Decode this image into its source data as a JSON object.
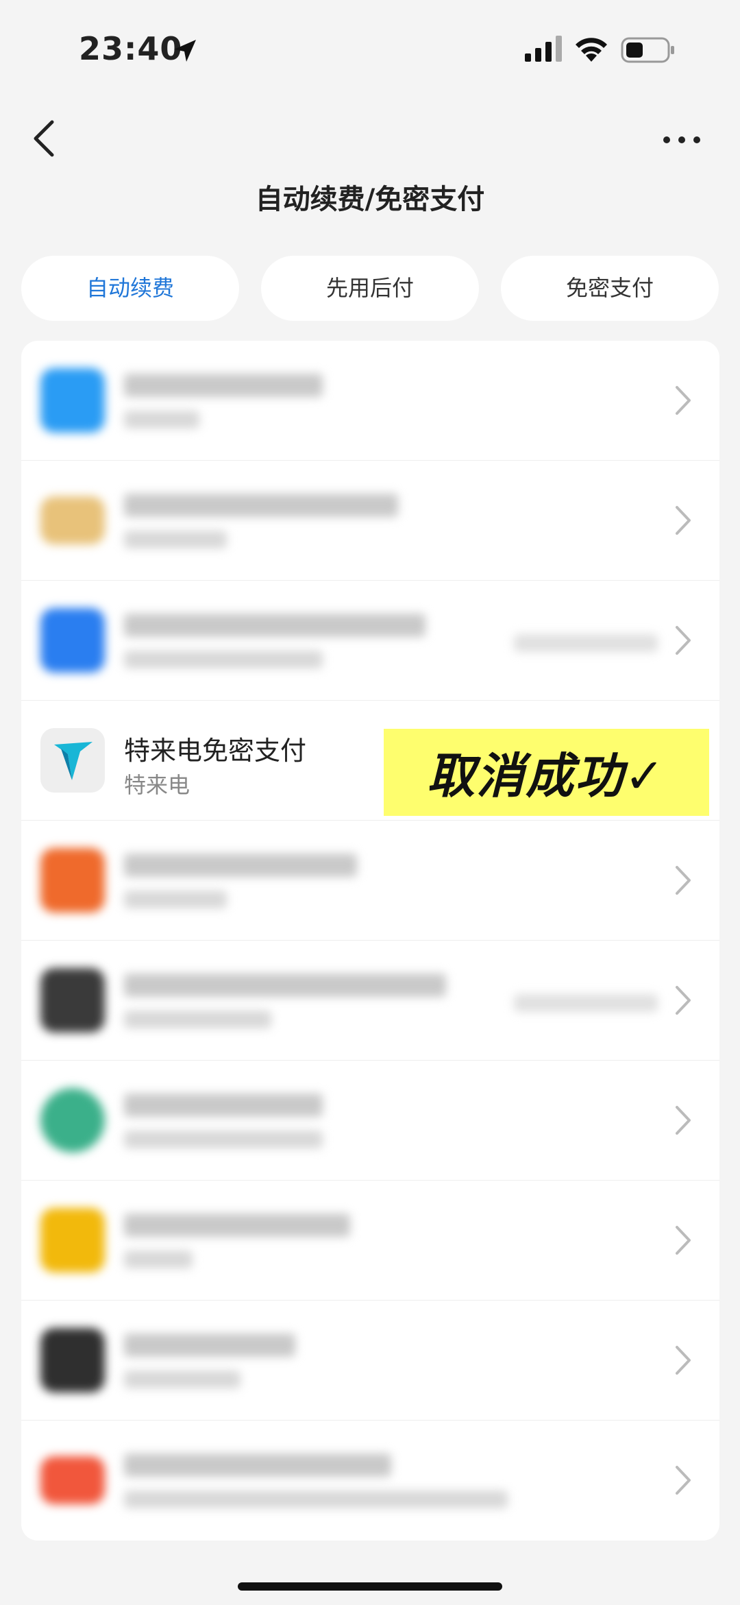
{
  "status_bar": {
    "time": "23:40"
  },
  "nav": {
    "title": "自动续费/免密支付"
  },
  "tabs": [
    {
      "label": "自动续费",
      "active": true
    },
    {
      "label": "先用后付",
      "active": false
    },
    {
      "label": "免密支付",
      "active": false
    }
  ],
  "list": {
    "visible_item": {
      "name": "特来电免密支付",
      "subtitle": "特来电"
    }
  },
  "overlay": {
    "text": "取消成功✓"
  },
  "colors": {
    "accent": "#1f76d8",
    "highlight": "#fefe6e"
  }
}
